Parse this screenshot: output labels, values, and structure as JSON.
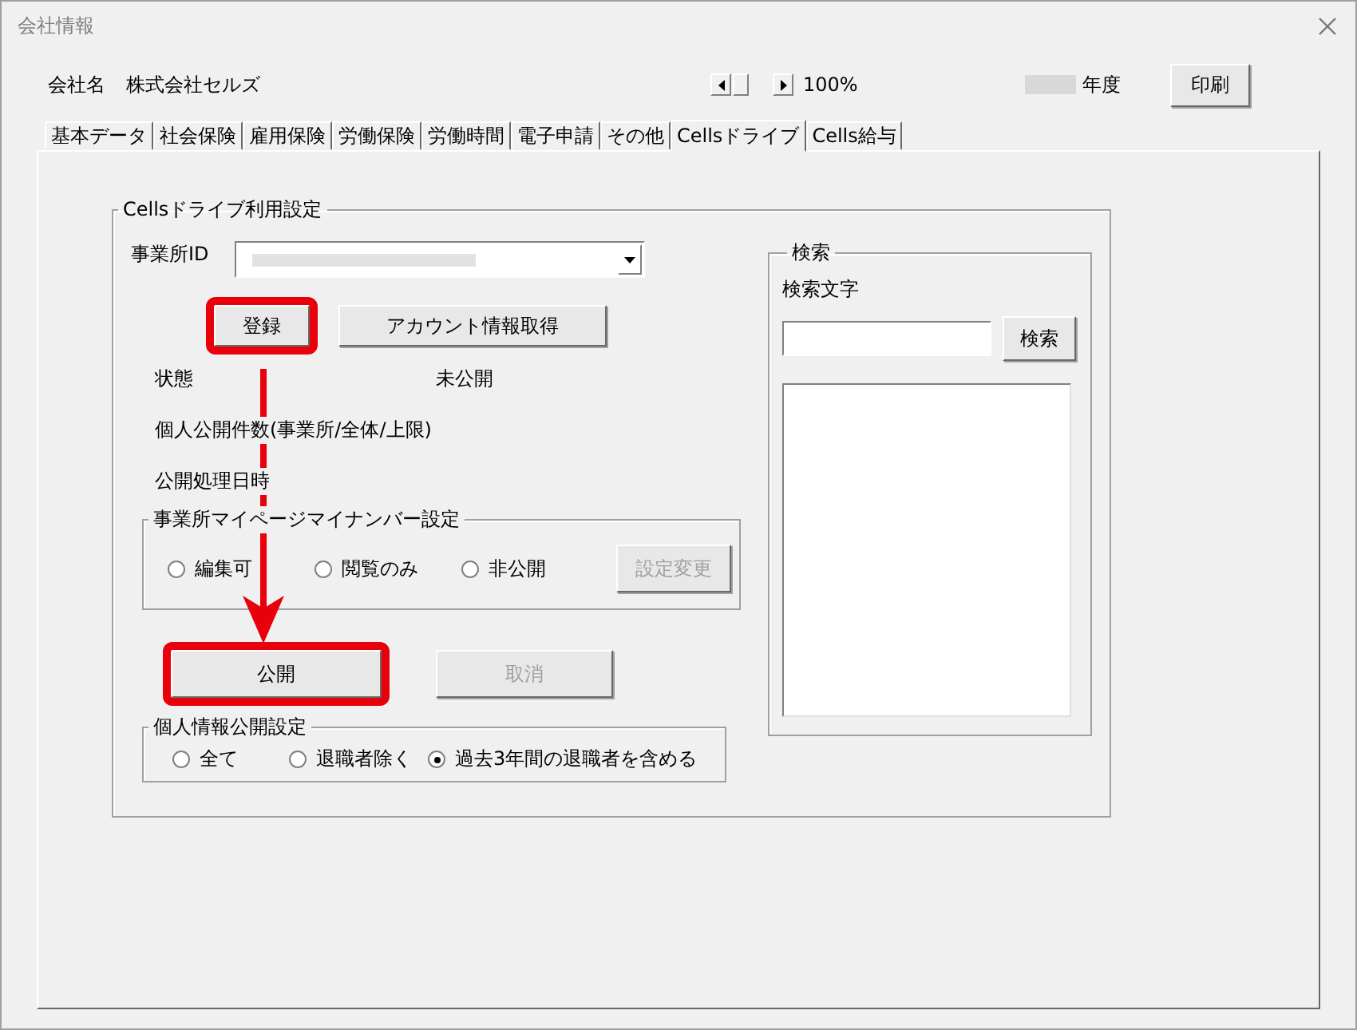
{
  "window": {
    "title": "会社情報"
  },
  "header": {
    "company_label": "会社名",
    "company_name": "株式会社セルズ",
    "zoom": "100%",
    "year_label": "年度",
    "print_button": "印刷"
  },
  "tabs": [
    {
      "label": "基本データ",
      "selected": false
    },
    {
      "label": "社会保険",
      "selected": false
    },
    {
      "label": "雇用保険",
      "selected": false
    },
    {
      "label": "労働保険",
      "selected": false
    },
    {
      "label": "労働時間",
      "selected": false
    },
    {
      "label": "電子申請",
      "selected": false
    },
    {
      "label": "その他",
      "selected": false
    },
    {
      "label": "Cellsドライブ",
      "selected": true
    },
    {
      "label": "Cells給与",
      "selected": false
    }
  ],
  "drive_settings": {
    "title": "Cellsドライブ利用設定",
    "office_id_label": "事業所ID",
    "buttons": [
      {
        "label": "登録",
        "disabled": false,
        "highlighted": true
      },
      {
        "label": "アカウント情報取得",
        "disabled": false,
        "highlighted": false
      }
    ],
    "status_rows": [
      {
        "label": "状態",
        "value": "未公開"
      },
      {
        "label": "個人公開件数(事業所/全体/上限)"
      },
      {
        "label": "公開処理日時"
      }
    ],
    "mypage_group": {
      "title": "事業所マイページマイナンバー設定",
      "options": [
        {
          "label": "編集可",
          "selected": false
        },
        {
          "label": "閲覧のみ",
          "selected": false
        },
        {
          "label": "非公開",
          "selected": false
        }
      ],
      "apply_button": {
        "label": "設定変更",
        "disabled": true
      }
    },
    "publish_buttons": [
      {
        "label": "公開",
        "disabled": false,
        "highlighted": true
      },
      {
        "label": "取消",
        "disabled": true,
        "highlighted": false
      }
    ],
    "personal_group": {
      "title": "個人情報公開設定",
      "options": [
        {
          "label": "全て",
          "selected": false
        },
        {
          "label": "退職者除く",
          "selected": false
        },
        {
          "label": "過去3年間の退職者を含める",
          "selected": true
        }
      ]
    }
  },
  "search": {
    "title": "検索",
    "field_label": "検索文字",
    "button": "検索"
  }
}
